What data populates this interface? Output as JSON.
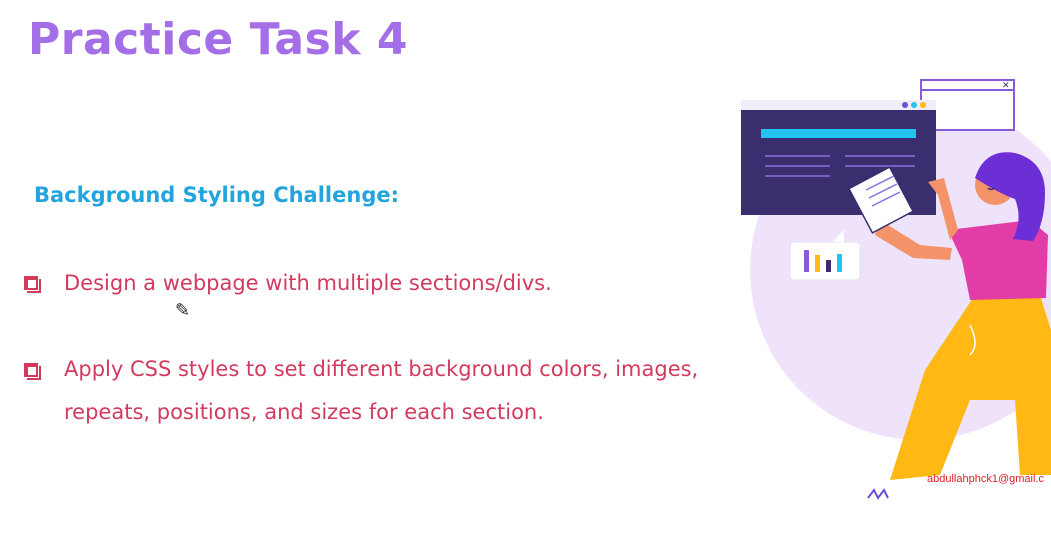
{
  "slide": {
    "title": "Practice Task 4",
    "subtitle": "Background Styling Challenge:",
    "items": [
      {
        "text": "Design a webpage with multiple sections/divs."
      },
      {
        "text": "Apply CSS styles to set different background colors, images, repeats, positions, and sizes for each section."
      }
    ],
    "watermark": "abdullahphck1@gmail.c"
  },
  "colors": {
    "title": "#a46ee6",
    "subtitle": "#24a4dc",
    "body_text": "#d23a5e",
    "illustration_panel": "#3b2e6e",
    "illustration_accent": "#22c5f0",
    "illustration_circle": "#efe3fb",
    "figure_shirt": "#e23ca6",
    "figure_pants": "#ffb814",
    "figure_hair": "#6c2fd6"
  },
  "icons": {
    "bullets": "hollow-square-checkbox-icon",
    "cursor": "pen-cursor-icon"
  }
}
